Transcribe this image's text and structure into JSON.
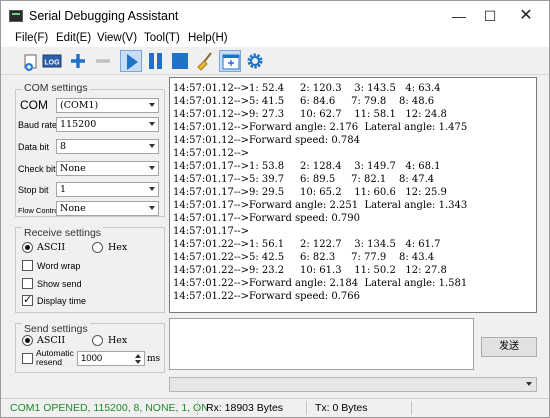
{
  "window": {
    "title": "Serial Debugging Assistant"
  },
  "menu": [
    "File(F)",
    "Edit(E)",
    "View(V)",
    "Tool(T)",
    "Help(H)"
  ],
  "toolbar": {
    "icons": [
      "new-icon",
      "log-icon",
      "plus-icon",
      "minus-icon",
      "play-icon",
      "pause-icon",
      "stop-icon",
      "broom-icon",
      "add-window-icon",
      "gear-icon"
    ],
    "log_label": "LOG"
  },
  "com_settings": {
    "title": "COM settings",
    "com_label": "COM",
    "com_value": "(COM1)",
    "baud_label": "Baud rate",
    "baud_value": "115200",
    "databit_label": "Data bit",
    "databit_value": "8",
    "checkbit_label": "Check bit",
    "checkbit_value": "None",
    "stopbit_label": "Stop bit",
    "stopbit_value": "1",
    "flow_label": "Flow Control",
    "flow_value": "None"
  },
  "receive_settings": {
    "title": "Receive settings",
    "ascii_label": "ASCII",
    "hex_label": "Hex",
    "word_wrap": "Word wrap",
    "show_send": "Show send",
    "display_time": "Display time"
  },
  "send_settings": {
    "title": "Send settings",
    "ascii_label": "ASCII",
    "hex_label": "Hex",
    "auto_resend": "Automatic resend",
    "auto_resend_line1": "Automatic",
    "auto_resend_line2": "resend",
    "interval": "1000",
    "unit": "ms"
  },
  "output_lines": [
    "14:57:01.12-->1: 52.4     2: 120.3    3: 143.5   4: 63.4",
    "14:57:01.12-->5: 41.5     6: 84.6     7: 79.8    8: 48.6",
    "14:57:01.12-->9: 27.3     10: 62.7    11: 58.1   12: 24.8",
    "14:57:01.12-->Forward angle: 2.176  Lateral angle: 1.475",
    "14:57:01.12-->Forward speed: 0.784",
    "14:57:01.12-->",
    "14:57:01.17-->1: 53.8     2: 128.4    3: 149.7   4: 68.1",
    "14:57:01.17-->5: 39.7     6: 89.5     7: 82.1    8: 47.4",
    "14:57:01.17-->9: 29.5     10: 65.2    11: 60.6   12: 25.9",
    "14:57:01.17-->Forward angle: 2.251  Lateral angle: 1.343",
    "14:57:01.17-->Forward speed: 0.790",
    "14:57:01.17-->",
    "14:57:01.22-->1: 56.1     2: 122.7    3: 134.5   4: 61.7",
    "14:57:01.22-->5: 42.5     6: 82.3     7: 77.9    8: 43.4",
    "14:57:01.22-->9: 23.2     10: 61.3    11: 50.2   12: 27.8",
    "14:57:01.22-->Forward angle: 2.184  Lateral angle: 1.581",
    "14:57:01.22-->Forward speed: 0.766"
  ],
  "send_button": "发送",
  "status": {
    "port": "COM1 OPENED, 115200, 8, NONE, 1, ON",
    "rx": "Rx: 18903 Bytes",
    "tx": "Tx: 0 Bytes"
  },
  "colors": {
    "status_green": "#1f8a2b",
    "toolbar_blue": "#1e73c8"
  }
}
